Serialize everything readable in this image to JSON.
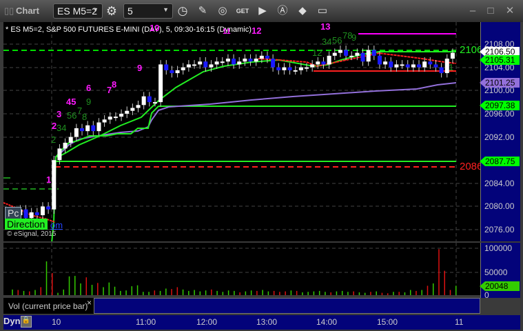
{
  "window": {
    "title": "Chart",
    "symbol": "ES M5=2",
    "interval": "5"
  },
  "chart": {
    "header": "* ES M5=2, S&P 500 FUTURES E-MINI (DAY), 5, 09:30-16:15 (Dynamic)",
    "copyright": "© eSignal, 2015",
    "direction_label": "Direction",
    "pc_label": "Pc",
    "om_label": "om",
    "level_labels": [
      "2106",
      "2086"
    ],
    "annotations": [
      "1",
      "2",
      "3",
      "45",
      "6",
      "7",
      "8",
      "9",
      "10",
      "11",
      "12",
      "13",
      "2",
      "34",
      "56",
      "7",
      "8",
      "9",
      "12",
      "34",
      "56",
      "78",
      "9",
      "1"
    ],
    "price_axis": [
      "2108.00",
      "2104.00",
      "2100.00",
      "2096.00",
      "2092.00",
      "2084.00",
      "2080.00",
      "2076.00"
    ],
    "price_tags": [
      {
        "value": "2106.50",
        "color": "#ffffff"
      },
      {
        "value": "2105.31",
        "color": "#00ff00"
      },
      {
        "value": "2101.25",
        "color": "#9370db"
      },
      {
        "value": "2097.38",
        "color": "#00ff00"
      },
      {
        "value": "2087.75",
        "color": "#00ff00"
      }
    ],
    "closes": [
      2079,
      2078.5,
      2079.5,
      2078,
      2079,
      2078.5,
      2080,
      2079.5,
      2088,
      2090,
      2091,
      2092,
      2093.5,
      2093,
      2094,
      2093,
      2094.5,
      2095,
      2095.5,
      2095.5,
      2096,
      2096.5,
      2097,
      2097.5,
      2099,
      2098,
      2098,
      2104.5,
      2103.5,
      2103,
      2103.5,
      2104,
      2104.5,
      2104.5,
      2105,
      2104,
      2104.5,
      2105,
      2105,
      2105.5,
      2104.5,
      2105,
      2105.5,
      2105,
      2105.5,
      2106,
      2105.5,
      2104,
      2103.5,
      2104,
      2103.5,
      2103.5,
      2104,
      2104,
      2104.5,
      2105,
      2104.5,
      2106,
      2106.5,
      2107,
      2106,
      2106,
      2106.5,
      2105,
      2107,
      2106,
      2104.5,
      2105,
      2104,
      2104.5,
      2104.5,
      2104,
      2104.5,
      2104,
      2105,
      2104.5,
      2104,
      2103,
      2105.5,
      2106.5
    ]
  },
  "volume": {
    "label": "Vol (current price bar)",
    "close_label": "×",
    "axis": [
      "100000",
      "50000",
      "0"
    ],
    "current": "20048",
    "bars": [
      12000,
      11000,
      9000,
      8000,
      11000,
      17000,
      72000,
      47000,
      5000,
      12000,
      40000,
      41000,
      25000,
      38000,
      22000,
      26000,
      17000,
      27000,
      18000,
      9000,
      10000,
      19000,
      21000,
      7000,
      7000,
      10000,
      9000,
      14000,
      13000,
      17000,
      12000,
      9000,
      11000,
      8000,
      10000,
      12000,
      9000,
      7000,
      10000,
      9000,
      6000,
      8000,
      10000,
      9000,
      11000,
      8000,
      9000,
      7000,
      8000,
      10000,
      9000,
      6000,
      7000,
      8000,
      9000,
      7000,
      6000,
      8000,
      9000,
      7000,
      8000,
      6000,
      5000,
      7000,
      8000,
      5000,
      4000,
      7000,
      7000,
      6000,
      11000,
      9000,
      11000,
      20000,
      25000,
      98000,
      52000,
      11000,
      20048
    ]
  },
  "time_axis": {
    "mode": "Dyn",
    "labels": [
      "10",
      "11:00",
      "12:00",
      "13:00",
      "14:00",
      "15:00",
      "11"
    ]
  }
}
